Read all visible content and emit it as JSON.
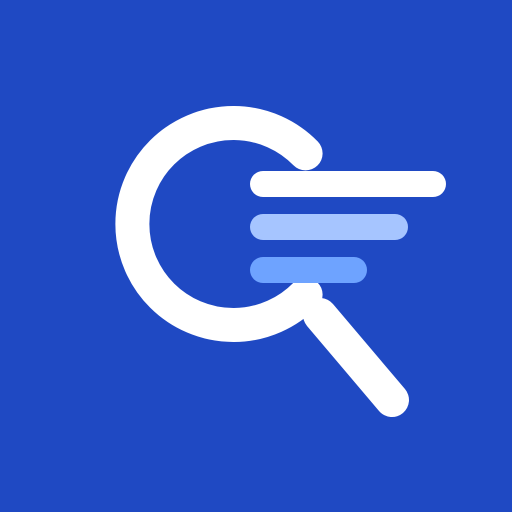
{
  "icon": {
    "name": "search-results-app-icon",
    "background_color": "#1F49C3",
    "magnifier_color": "#FFFFFF",
    "lines": [
      {
        "name": "result-line-1",
        "color": "#FFFFFF"
      },
      {
        "name": "result-line-2",
        "color": "#A6C5FF"
      },
      {
        "name": "result-line-3",
        "color": "#6EA3FF"
      }
    ]
  }
}
